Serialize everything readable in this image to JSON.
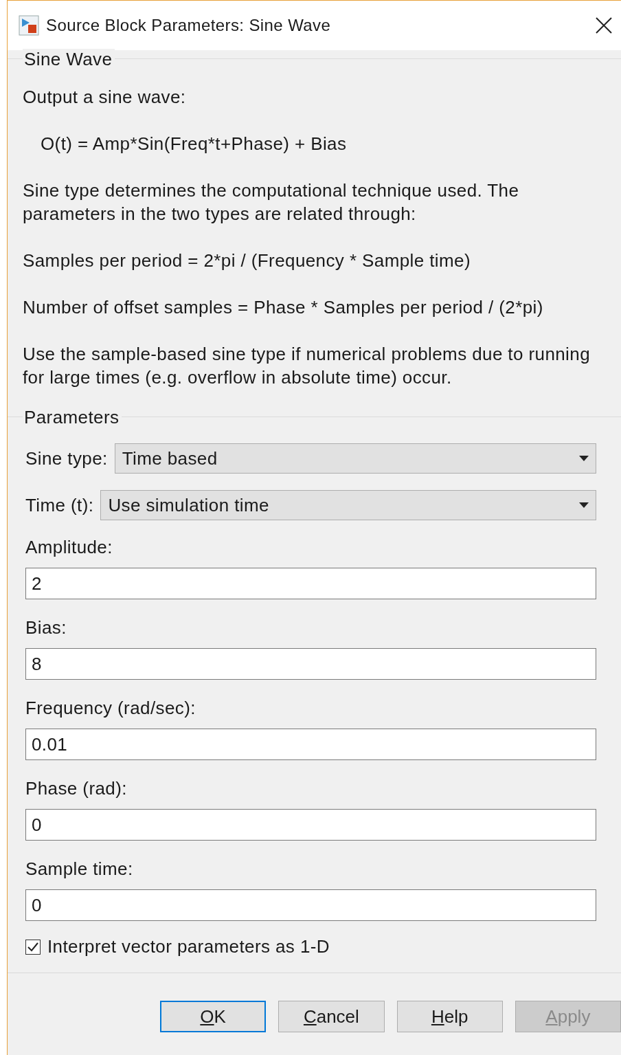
{
  "window": {
    "title": "Source Block Parameters: Sine Wave"
  },
  "description": {
    "legend": "Sine Wave",
    "paragraphs": [
      {
        "kind": "text",
        "text": "Output a sine wave:"
      },
      {
        "kind": "formula",
        "text": "O(t) = Amp*Sin(Freq*t+Phase) + Bias"
      },
      {
        "kind": "text",
        "text": "Sine type determines the computational technique used. The parameters in the two types are related through:"
      },
      {
        "kind": "text",
        "text": "Samples per period = 2*pi / (Frequency * Sample time)"
      },
      {
        "kind": "text",
        "text": "Number of offset samples = Phase * Samples per period / (2*pi)"
      },
      {
        "kind": "text",
        "text": "Use the sample-based sine type if numerical problems due to running for large times (e.g. overflow in absolute time) occur."
      }
    ]
  },
  "parameters": {
    "legend": "Parameters",
    "items": [
      {
        "kind": "dropdown",
        "label": "Sine type:",
        "value": "Time based"
      },
      {
        "kind": "dropdown",
        "label": "Time (t):",
        "value": "Use simulation time"
      },
      {
        "kind": "field",
        "label": "Amplitude:",
        "value": "2"
      },
      {
        "kind": "field",
        "label": "Bias:",
        "value": "8"
      },
      {
        "kind": "field",
        "label": "Frequency (rad/sec):",
        "value": "0.01"
      },
      {
        "kind": "field",
        "label": "Phase (rad):",
        "value": "0"
      },
      {
        "kind": "field",
        "label": "Sample time:",
        "value": "0"
      },
      {
        "kind": "checkbox",
        "label": "Interpret vector parameters as 1-D",
        "checked": true
      }
    ]
  },
  "buttons": [
    {
      "label": "OK",
      "default": true,
      "disabled": false
    },
    {
      "label": "Cancel",
      "default": false,
      "disabled": false
    },
    {
      "label": "Help",
      "default": false,
      "disabled": false
    },
    {
      "label": "Apply",
      "default": false,
      "disabled": true
    }
  ]
}
